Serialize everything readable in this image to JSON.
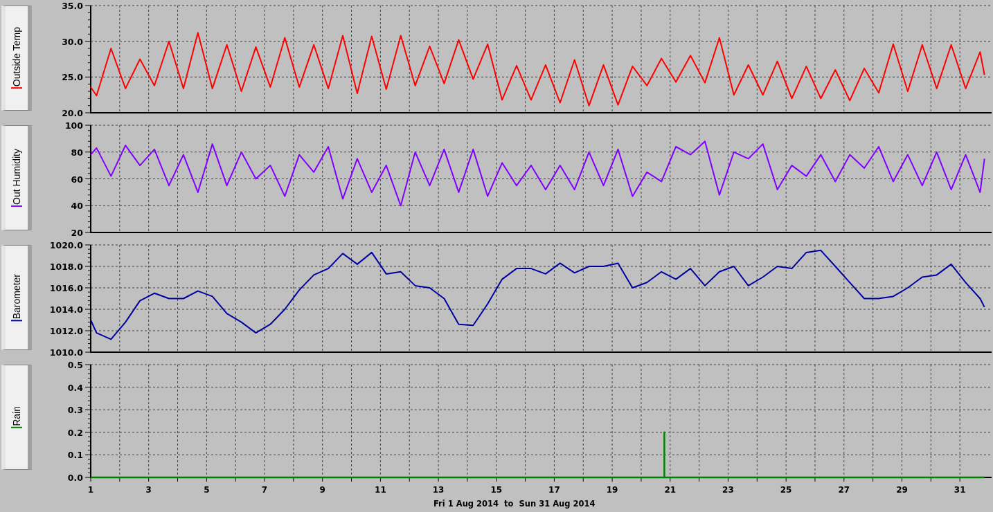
{
  "panels": [
    {
      "chart_data": {
        "type": "line",
        "grid": true,
        "xlim": [
          1,
          32
        ],
        "ylim": [
          20,
          35
        ],
        "yticks": [
          {
            "value": 20,
            "label": "20.0"
          },
          {
            "value": 25,
            "label": "25.0"
          },
          {
            "value": 30,
            "label": "30.0"
          },
          {
            "value": 35,
            "label": "35.0"
          }
        ],
        "x": [
          1.0,
          1.2,
          1.7,
          2.2,
          2.7,
          3.2,
          3.7,
          4.2,
          4.7,
          5.2,
          5.7,
          6.2,
          6.7,
          7.2,
          7.7,
          8.2,
          8.7,
          9.2,
          9.7,
          10.2,
          10.7,
          11.2,
          11.7,
          12.2,
          12.7,
          13.2,
          13.7,
          14.2,
          14.7,
          15.2,
          15.7,
          16.2,
          16.7,
          17.2,
          17.7,
          18.2,
          18.7,
          19.2,
          19.7,
          20.2,
          20.7,
          21.2,
          21.7,
          22.2,
          22.7,
          23.2,
          23.7,
          24.2,
          24.7,
          25.2,
          25.7,
          26.2,
          26.7,
          27.2,
          27.7,
          28.2,
          28.7,
          29.2,
          29.7,
          30.2,
          30.7,
          31.2,
          31.7,
          31.85
        ],
        "series": [
          {
            "name": "Outside Temp",
            "color": "#ff0000",
            "values": [
              23.6,
              22.4,
              29.0,
              23.4,
              27.5,
              23.8,
              30.0,
              23.4,
              31.2,
              23.4,
              29.5,
              23.0,
              29.2,
              23.6,
              30.5,
              23.6,
              29.5,
              23.4,
              30.8,
              22.7,
              30.7,
              23.3,
              30.8,
              23.8,
              29.3,
              24.1,
              30.2,
              24.7,
              29.6,
              21.8,
              26.6,
              21.8,
              26.7,
              21.4,
              27.4,
              21.0,
              26.7,
              21.1,
              26.5,
              23.8,
              27.6,
              24.3,
              28.0,
              24.2,
              30.5,
              22.5,
              26.7,
              22.5,
              27.2,
              22.0,
              26.5,
              22.0,
              26.0,
              21.7,
              26.2,
              22.8,
              29.6,
              23.0,
              29.5,
              23.4,
              29.5,
              23.4,
              28.5,
              25.3
            ]
          }
        ]
      }
    },
    {
      "chart_data": {
        "type": "line",
        "grid": true,
        "xlim": [
          1,
          32
        ],
        "ylim": [
          20,
          100
        ],
        "yticks": [
          20,
          40,
          60,
          80,
          100
        ],
        "x": [
          1.0,
          1.2,
          1.7,
          2.2,
          2.7,
          3.2,
          3.7,
          4.2,
          4.7,
          5.2,
          5.7,
          6.2,
          6.7,
          7.2,
          7.7,
          8.2,
          8.7,
          9.2,
          9.7,
          10.2,
          10.7,
          11.2,
          11.7,
          12.2,
          12.7,
          13.2,
          13.7,
          14.2,
          14.7,
          15.2,
          15.7,
          16.2,
          16.7,
          17.2,
          17.7,
          18.2,
          18.7,
          19.2,
          19.7,
          20.2,
          20.7,
          21.2,
          21.7,
          22.2,
          22.7,
          23.2,
          23.7,
          24.2,
          24.7,
          25.2,
          25.7,
          26.2,
          26.7,
          27.2,
          27.7,
          28.2,
          28.7,
          29.2,
          29.7,
          30.2,
          30.7,
          31.2,
          31.7,
          31.85
        ],
        "series": [
          {
            "name": "Out Humidity",
            "color": "#8000ff",
            "values": [
              78,
              83,
              62,
              85,
              70,
              82,
              55,
              78,
              50,
              86,
              55,
              80,
              60,
              70,
              47,
              78,
              65,
              84,
              45,
              75,
              50,
              70,
              40,
              80,
              55,
              82,
              50,
              82,
              47,
              72,
              55,
              70,
              52,
              70,
              52,
              80,
              55,
              82,
              47,
              65,
              58,
              84,
              78,
              88,
              48,
              80,
              75,
              86,
              52,
              70,
              62,
              78,
              58,
              78,
              68,
              84,
              58,
              78,
              55,
              80,
              52,
              78,
              50,
              75
            ]
          }
        ]
      }
    },
    {
      "chart_data": {
        "type": "line",
        "grid": true,
        "xlim": [
          1,
          32
        ],
        "ylim": [
          1010,
          1020
        ],
        "yticks": [
          {
            "value": 1010,
            "label": "1010.0"
          },
          {
            "value": 1012,
            "label": "1012.0"
          },
          {
            "value": 1014,
            "label": "1014.0"
          },
          {
            "value": 1016,
            "label": "1016.0"
          },
          {
            "value": 1018,
            "label": "1018.0"
          },
          {
            "value": 1020,
            "label": "1020.0"
          }
        ],
        "x": [
          1.0,
          1.2,
          1.7,
          2.2,
          2.7,
          3.2,
          3.7,
          4.2,
          4.7,
          5.2,
          5.7,
          6.2,
          6.7,
          7.2,
          7.7,
          8.2,
          8.7,
          9.2,
          9.7,
          10.2,
          10.7,
          11.2,
          11.7,
          12.2,
          12.7,
          13.2,
          13.7,
          14.2,
          14.7,
          15.2,
          15.7,
          16.2,
          16.7,
          17.2,
          17.7,
          18.2,
          18.7,
          19.2,
          19.7,
          20.2,
          20.7,
          21.2,
          21.7,
          22.2,
          22.7,
          23.2,
          23.7,
          24.2,
          24.7,
          25.2,
          25.7,
          26.2,
          26.7,
          27.2,
          27.7,
          28.2,
          28.7,
          29.2,
          29.7,
          30.2,
          30.7,
          31.2,
          31.7,
          31.85
        ],
        "series": [
          {
            "name": "Barometer",
            "color": "#0000a0",
            "values": [
              1013.0,
              1011.8,
              1011.2,
              1012.8,
              1014.8,
              1015.5,
              1015.0,
              1015.0,
              1015.7,
              1015.2,
              1013.6,
              1012.8,
              1011.8,
              1012.6,
              1014.0,
              1015.8,
              1017.2,
              1017.8,
              1019.2,
              1018.2,
              1019.3,
              1017.3,
              1017.5,
              1016.2,
              1016.0,
              1015.0,
              1012.6,
              1012.5,
              1014.5,
              1016.8,
              1017.8,
              1017.8,
              1017.3,
              1018.3,
              1017.4,
              1018.0,
              1018.0,
              1018.3,
              1016.0,
              1016.5,
              1017.5,
              1016.8,
              1017.8,
              1016.2,
              1017.5,
              1018.0,
              1016.2,
              1017.0,
              1018.0,
              1017.8,
              1019.3,
              1019.5,
              1018.0,
              1016.5,
              1015.0,
              1015.0,
              1015.2,
              1016.0,
              1017.0,
              1017.2,
              1018.2,
              1016.5,
              1015.0,
              1014.2
            ]
          }
        ]
      }
    },
    {
      "chart_data": {
        "type": "line",
        "grid": true,
        "xlim": [
          1,
          32
        ],
        "ylim": [
          0,
          0.5
        ],
        "yticks": [
          {
            "value": 0,
            "label": "0.0"
          },
          {
            "value": 0.1,
            "label": "0.1"
          },
          {
            "value": 0.2,
            "label": "0.2"
          },
          {
            "value": 0.3,
            "label": "0.3"
          },
          {
            "value": 0.4,
            "label": "0.4"
          },
          {
            "value": 0.5,
            "label": "0.5"
          }
        ],
        "xticks": [
          1,
          3,
          5,
          7,
          9,
          11,
          13,
          15,
          17,
          19,
          21,
          23,
          25,
          27,
          29,
          31
        ],
        "x": [
          1.0,
          20.8,
          20.8,
          20.8,
          31.85
        ],
        "series": [
          {
            "name": "Rain",
            "color": "#008000",
            "values": [
              0,
              0,
              0.2,
              0,
              0
            ]
          }
        ]
      }
    }
  ],
  "date_range": "Fri 1 Aug 2014  to  Sun 31 Aug 2014"
}
